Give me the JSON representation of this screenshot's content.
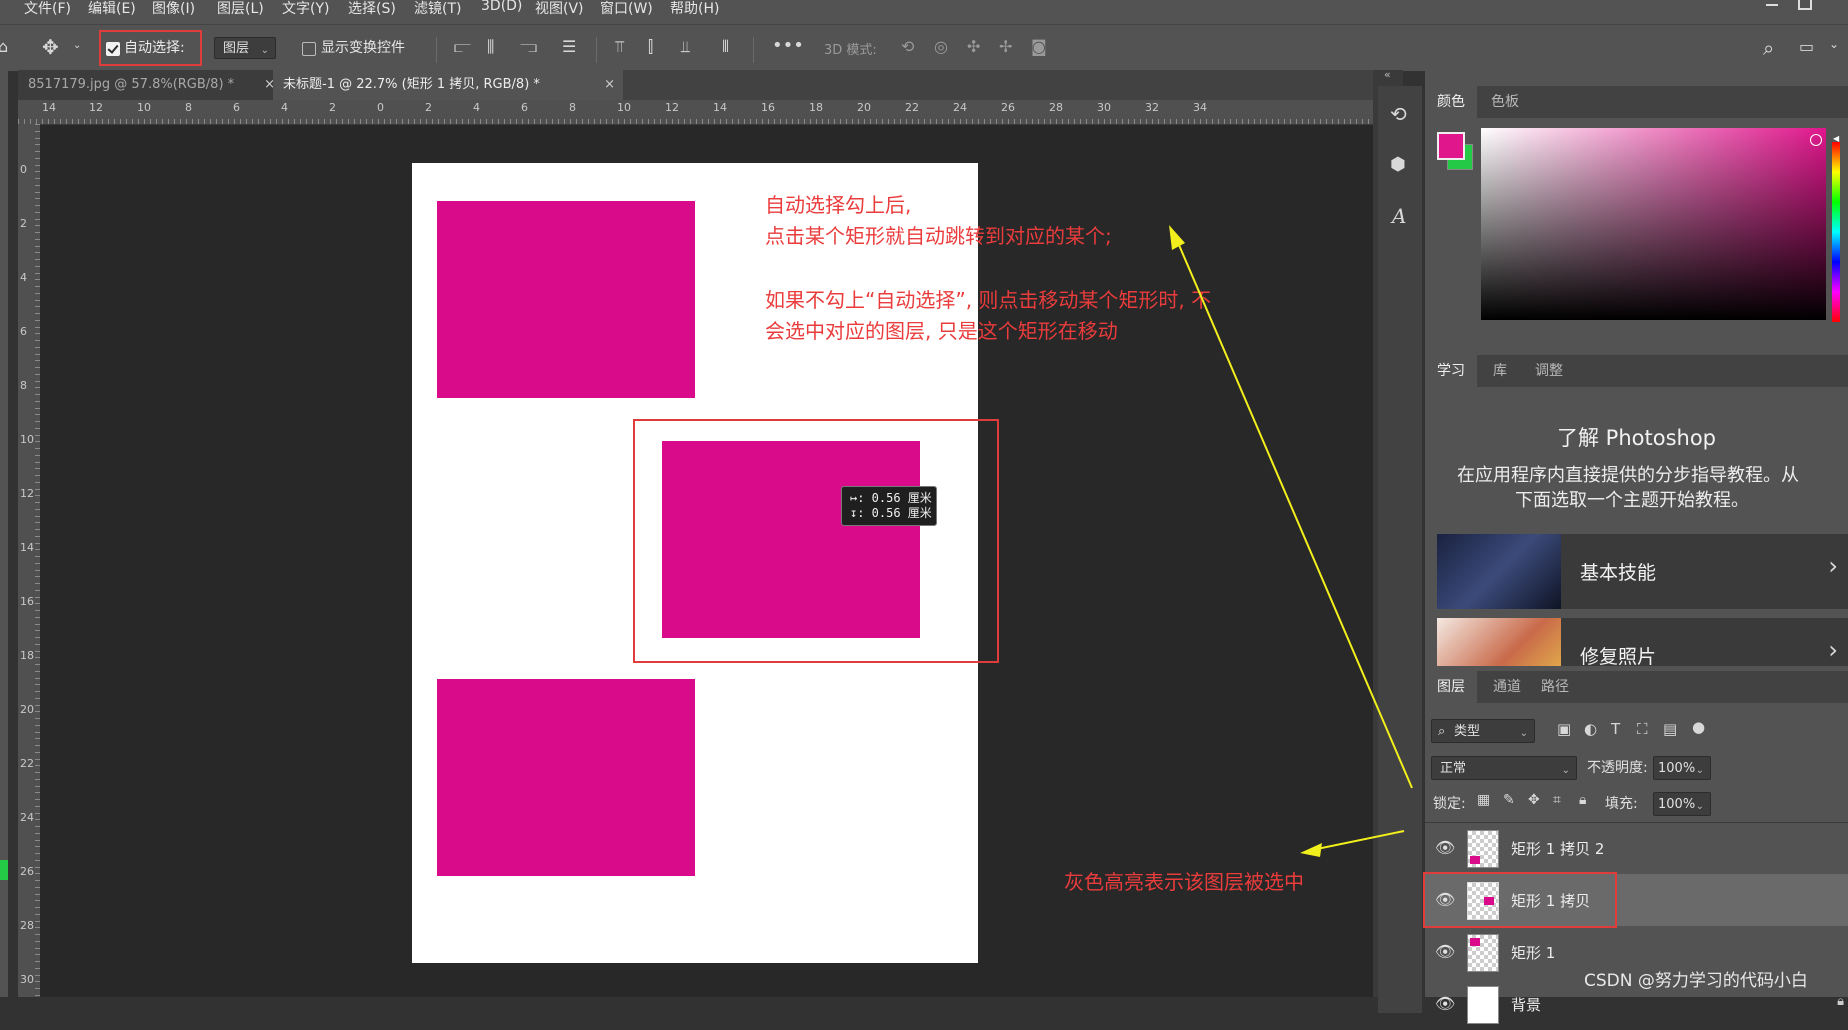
{
  "menu": [
    "文件(F)",
    "编辑(E)",
    "图像(I)",
    "图层(L)",
    "文字(Y)",
    "选择(S)",
    "滤镜(T)",
    "3D(D)",
    "视图(V)",
    "窗口(W)",
    "帮助(H)"
  ],
  "options_bar": {
    "auto_select_label": "自动选择:",
    "auto_select_checked": true,
    "auto_select_target": "图层",
    "show_transform_label": "显示变换控件",
    "mode_3d_label": "3D 模式:"
  },
  "doc_tabs": [
    {
      "label": "8517179.jpg @ 57.8%(RGB/8) *",
      "active": false
    },
    {
      "label": "未标题-1 @ 22.7% (矩形 1 拷贝, RGB/8) *",
      "active": true
    }
  ],
  "ruler_h": [
    "14",
    "12",
    "10",
    "8",
    "6",
    "4",
    "2",
    "0",
    "2",
    "4",
    "6",
    "8",
    "10",
    "12",
    "14",
    "16",
    "18",
    "20",
    "22",
    "24",
    "26",
    "28",
    "30",
    "32",
    "34"
  ],
  "ruler_v": [
    "0",
    "2",
    "4",
    "6",
    "8",
    "10",
    "12",
    "14",
    "16",
    "18",
    "20",
    "22",
    "24",
    "26",
    "28",
    "30"
  ],
  "canvas": {
    "measure_line1": "↦: 0.56 厘米",
    "measure_line2": "↧: 0.56 厘米",
    "annotation_top_1": "自动选择勾上后,",
    "annotation_top_2": "点击某个矩形就自动跳转到对应的某个;",
    "annotation_top_3": "如果不勾上“自动选择”, 则点击移动某个矩形时, 不",
    "annotation_top_4": "会选中对应的图层, 只是这个矩形在移动",
    "annotation_bottom": "灰色高亮表示该图层被选中",
    "rect_color": "#d90b8a"
  },
  "color_panel": {
    "tabs": [
      "颜色",
      "色板"
    ],
    "foreground": "#e0168c",
    "background": "#24c946"
  },
  "learn_panel": {
    "tabs": [
      "学习",
      "库",
      "调整"
    ],
    "title": "了解 Photoshop",
    "desc_1": "在应用程序内直接提供的分步指导教程。从",
    "desc_2": "下面选取一个主题开始教程。",
    "cards": [
      "基本技能",
      "修复照片"
    ]
  },
  "layers_panel": {
    "tabs": [
      "图层",
      "通道",
      "路径"
    ],
    "filter_label": "类型",
    "blend_mode": "正常",
    "opacity_label": "不透明度:",
    "opacity_value": "100%",
    "lock_label": "锁定:",
    "fill_label": "填充:",
    "fill_value": "100%",
    "layers": [
      {
        "name": "矩形 1 拷贝 2",
        "selected": false
      },
      {
        "name": "矩形 1 拷贝",
        "selected": true
      },
      {
        "name": "矩形 1",
        "selected": false
      },
      {
        "name": "背景",
        "selected": false
      }
    ]
  },
  "watermark": "CSDN @努力学习的代码小白"
}
